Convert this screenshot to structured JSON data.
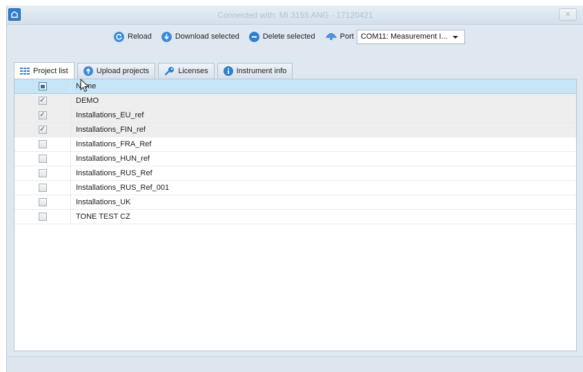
{
  "window": {
    "title": "Connected with: MI 3155 ANG - 17120421",
    "close_symbol": "✕"
  },
  "toolbar": {
    "reload_label": "Reload",
    "download_label": "Download selected",
    "delete_label": "Delete selected",
    "port_label": "Port",
    "port_value": "COM11: Measurement I..."
  },
  "tabs": [
    {
      "label": "Project list",
      "icon": "grid-icon",
      "active": true
    },
    {
      "label": "Upload projects",
      "icon": "upload-icon",
      "active": false
    },
    {
      "label": "Licenses",
      "icon": "key-icon",
      "active": false
    },
    {
      "label": "Instrument info",
      "icon": "info-icon",
      "active": false
    }
  ],
  "grid": {
    "header_name": "Name",
    "rows": [
      {
        "name": "DEMO",
        "checked": true
      },
      {
        "name": "Installations_EU_ref",
        "checked": true
      },
      {
        "name": "Installations_FIN_ref",
        "checked": true
      },
      {
        "name": "Installations_FRA_Ref",
        "checked": false
      },
      {
        "name": "Installations_HUN_ref",
        "checked": false
      },
      {
        "name": "Installations_RUS_Ref",
        "checked": false
      },
      {
        "name": "Installations_RUS_Ref_001",
        "checked": false
      },
      {
        "name": "Installations_UK",
        "checked": false
      },
      {
        "name": "TONE TEST CZ",
        "checked": false
      }
    ]
  },
  "colors": {
    "header_bg": "#c6e6f8",
    "checked_row_bg": "#eeeeee",
    "icon_blue": "#3c8bd9"
  }
}
